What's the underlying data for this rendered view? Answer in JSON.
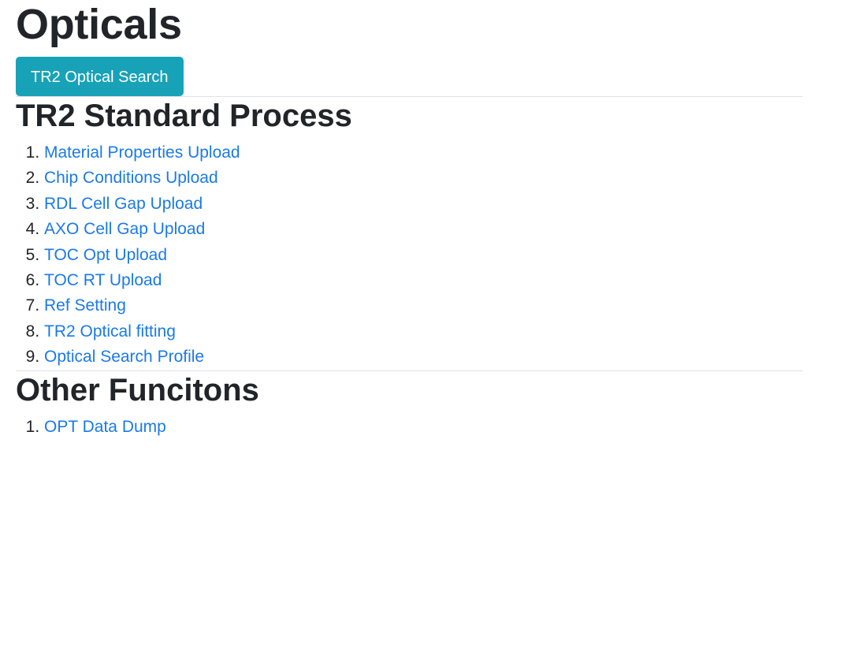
{
  "page": {
    "title": "Opticals",
    "search_button_label": "TR2 Optical Search"
  },
  "standard_process": {
    "title": "TR2 Standard Process",
    "items": [
      {
        "label": "Material Properties Upload"
      },
      {
        "label": "Chip Conditions Upload"
      },
      {
        "label": "RDL Cell Gap Upload"
      },
      {
        "label": "AXO Cell Gap Upload"
      },
      {
        "label": "TOC Opt Upload"
      },
      {
        "label": "TOC RT Upload"
      },
      {
        "label": "Ref Setting"
      },
      {
        "label": "TR2 Optical fitting"
      },
      {
        "label": "Optical Search Profile"
      }
    ]
  },
  "other_functions": {
    "title": "Other Funcitons",
    "items": [
      {
        "label": "OPT Data Dump"
      }
    ]
  },
  "colors": {
    "button_bg": "#17a2b8",
    "link": "#1a7ae8",
    "text": "#212529",
    "divider": "#dfe2e6"
  }
}
